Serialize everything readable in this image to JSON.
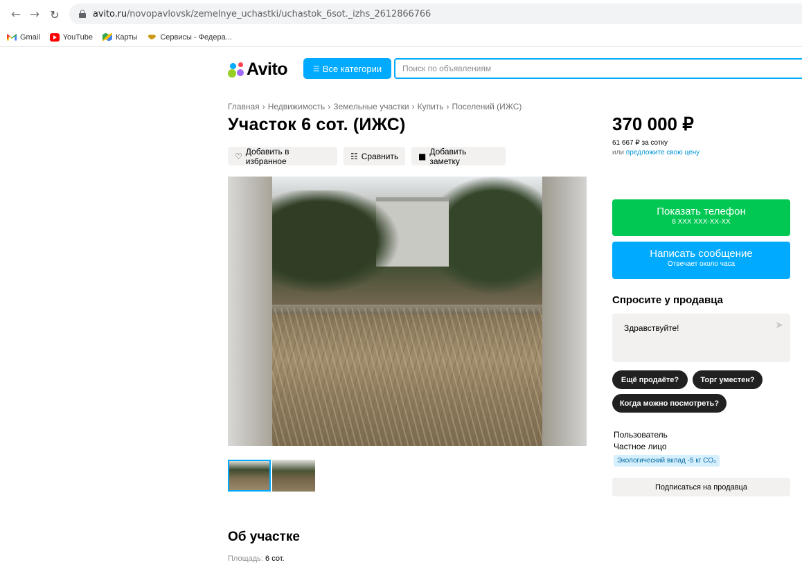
{
  "browser": {
    "url_host": "avito.ru",
    "url_path": "/novopavlovsk/zemelnye_uchastki/uchastok_6sot._izhs_2612866766",
    "bookmarks": [
      "Gmail",
      "YouTube",
      "Карты",
      "Сервисы - Федера..."
    ]
  },
  "header": {
    "logo_text": "Avito",
    "categories_label": "Все категории",
    "search_placeholder": "Поиск по объявлениям"
  },
  "breadcrumb": [
    "Главная",
    "Недвижимость",
    "Земельные участки",
    "Купить",
    "Поселений (ИЖС)"
  ],
  "breadcrumb_sep": "›",
  "listing": {
    "title": "Участок 6 сот. (ИЖС)",
    "actions": {
      "favorite": "Добавить в избранное",
      "compare": "Сравнить",
      "note": "Добавить заметку"
    },
    "photo_count": 2
  },
  "price": {
    "value": "370 000 ₽",
    "per_unit": "61 667 ₽ за сотку",
    "offer_prefix": "или",
    "offer_link": "предложите свою цену"
  },
  "contact": {
    "phone_label": "Показать телефон",
    "phone_masked": "8 XXX XXX-XX-XX",
    "message_label": "Написать сообщение",
    "message_sub": "Отвечает около часа"
  },
  "ask": {
    "title": "Спросите у продавца",
    "input_value": "Здравствуйте!",
    "chips": [
      "Ещё продаёте?",
      "Торг уместен?",
      "Когда можно посмотреть?"
    ]
  },
  "seller": {
    "name": "Пользователь",
    "type": "Частное лицо",
    "eco_badge": "Экологический вклад -5 кг CO₂",
    "subscribe": "Подписаться на продавца"
  },
  "about": {
    "title": "Об участке",
    "area_label": "Площадь:",
    "area_value": "6 сот."
  },
  "colors": {
    "brand_blue": "#00aaff",
    "phone_green": "#00c853",
    "chip_dark": "#212121",
    "light_bg": "#f2f1f0"
  }
}
